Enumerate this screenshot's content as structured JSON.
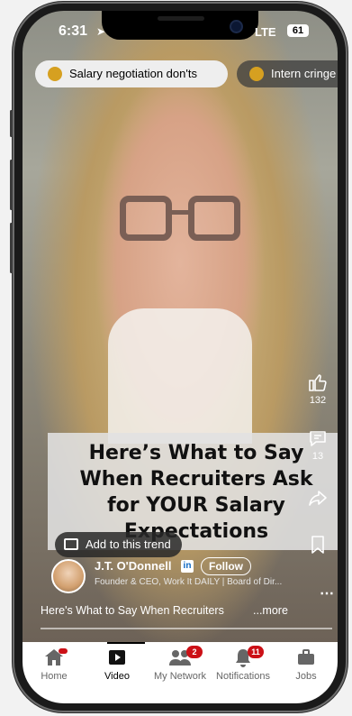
{
  "status_bar": {
    "time": "6:31",
    "network": "LTE",
    "battery": "61"
  },
  "trend_chips": [
    {
      "label": "Salary negotiation don'ts"
    },
    {
      "label": "Intern cringe sto"
    }
  ],
  "video": {
    "headline_lines": [
      "Here’s What to Say",
      "When Recruiters Ask",
      "for YOUR Salary",
      "Expectations"
    ],
    "add_trend_label": "Add to this trend"
  },
  "actions": {
    "likes": "132",
    "comments": "13"
  },
  "author": {
    "name": "J.T. O'Donnell",
    "linkedin_badge": "in",
    "follow_label": "Follow",
    "subtitle": "Founder & CEO, Work It DAILY | Board of Dir..."
  },
  "caption": {
    "text": "Here's What to Say When Recruiters",
    "more": "...more"
  },
  "more_icon": "⋯",
  "tabs": [
    {
      "label": "Home",
      "badge": ""
    },
    {
      "label": "Video",
      "badge": ""
    },
    {
      "label": "My Network",
      "badge": "2"
    },
    {
      "label": "Notifications",
      "badge": "11"
    },
    {
      "label": "Jobs",
      "badge": ""
    }
  ],
  "colors": {
    "badge": "#cc1016",
    "linkedin": "#0a66c2"
  }
}
